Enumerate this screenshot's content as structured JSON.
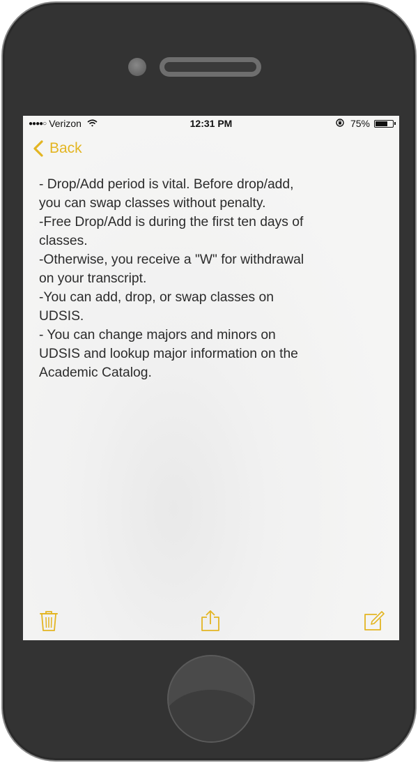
{
  "status_bar": {
    "signal": "●●●●○",
    "carrier": "Verizon",
    "time": "12:31 PM",
    "battery_percent": "75%",
    "battery_level": 0.75
  },
  "nav": {
    "back_label": "Back"
  },
  "note": {
    "lines": [
      "- Drop/Add period is vital. Before drop/add,",
      "you can swap classes without penalty.",
      "-Free Drop/Add is during the first ten days of",
      "classes.",
      "-Otherwise, you receive a \"W\" for withdrawal",
      "on your transcript.",
      "-You can add, drop, or swap classes on",
      "UDSIS.",
      "- You can change majors and minors on",
      "UDSIS and lookup major information on the",
      "Academic Catalog."
    ]
  },
  "toolbar": {
    "icons": [
      "trash-icon",
      "share-icon",
      "compose-icon"
    ]
  },
  "colors": {
    "accent": "#e3b522",
    "device_body": "#333333",
    "screen_bg": "#f4f4f3",
    "text": "#2b2b2b"
  }
}
